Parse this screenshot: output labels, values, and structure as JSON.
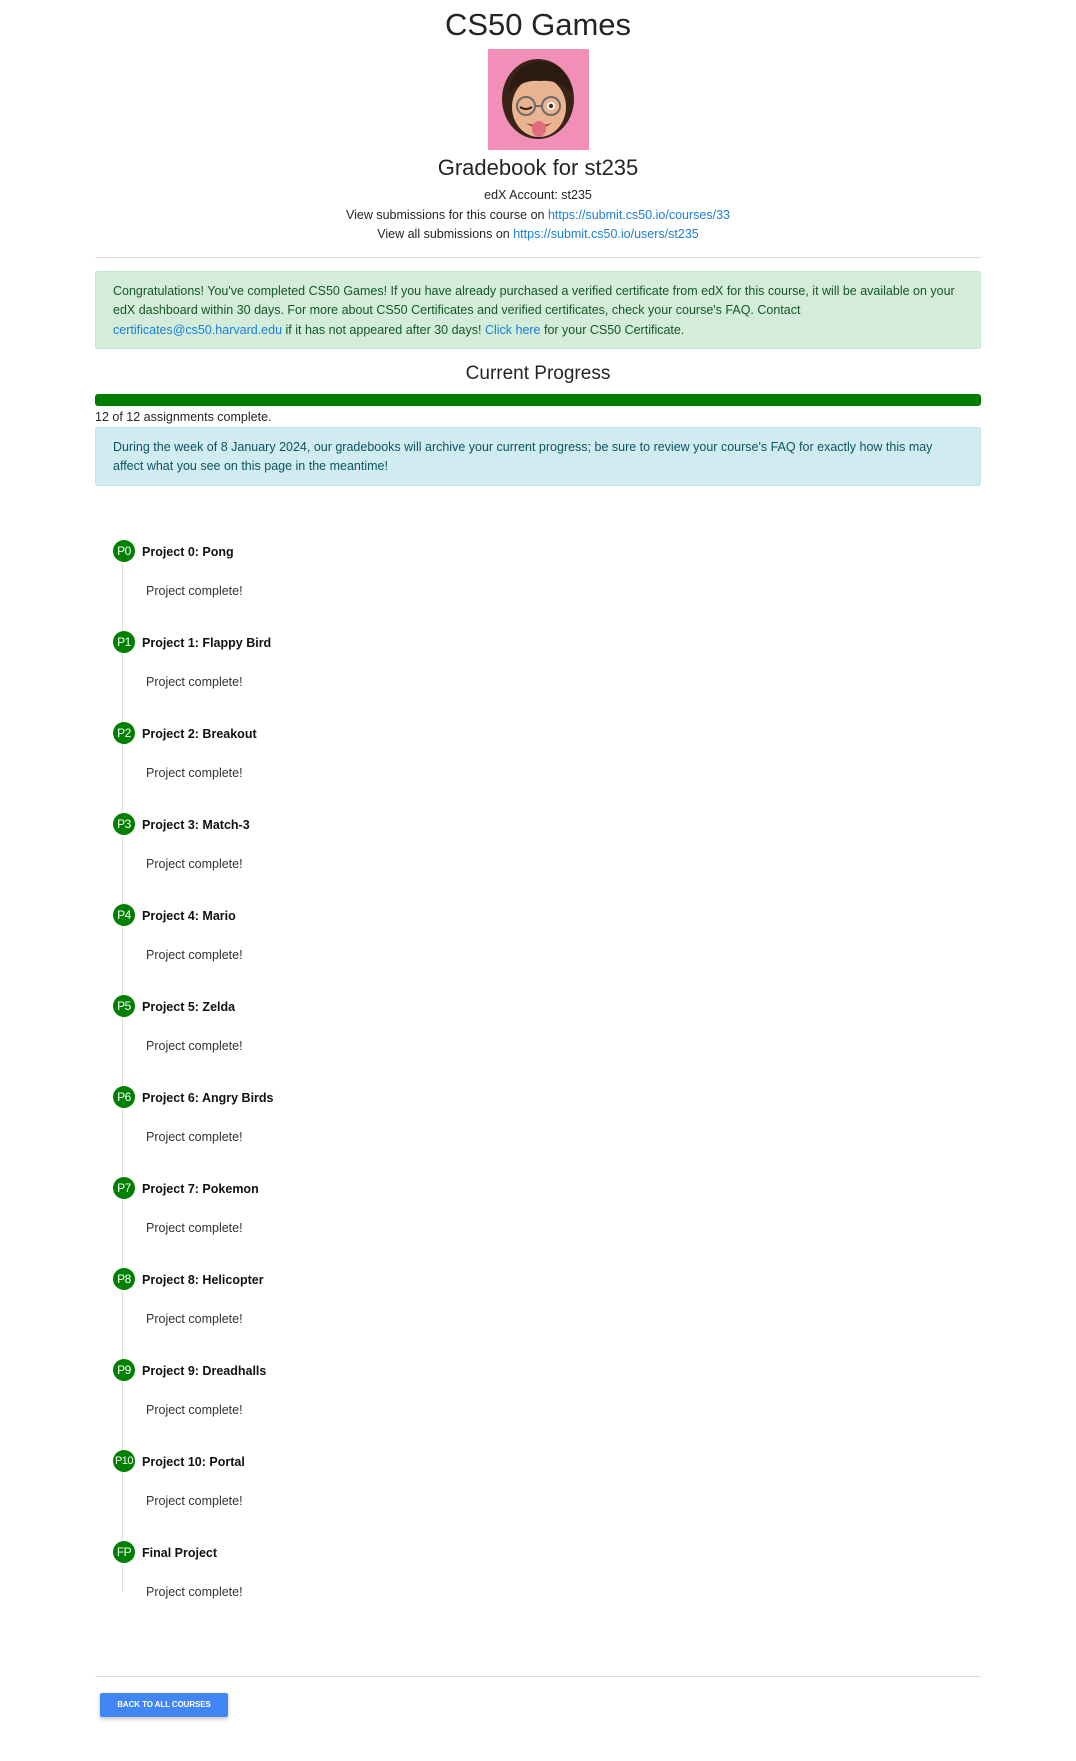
{
  "page": {
    "title": "CS50 Games",
    "subtitle": "Gradebook for st235",
    "edx_account_text": "edX Account: st235",
    "course_submissions_prefix": "View submissions for this course on ",
    "course_submissions_link": "https://submit.cs50.io/courses/33",
    "all_submissions_prefix": "View all submissions on ",
    "all_submissions_link": "https://submit.cs50.io/users/st235"
  },
  "avatar": {
    "icon": "memoji-avatar-icon",
    "background": "#f28fb8"
  },
  "congrats_alert": {
    "text_part1": "Congratulations! You've completed CS50 Games! If you have already purchased a verified certificate from edX for this course, it will be available on your edX dashboard within 30 days. For more about CS50 Certificates and verified certificates, check your course's FAQ. Contact ",
    "email_link": "certificates@cs50.harvard.edu",
    "text_part2": " if it has not appeared after 30 days! ",
    "click_here_link": "Click here",
    "text_part3": " for your CS50 Certificate."
  },
  "progress": {
    "title": "Current Progress",
    "completed": 12,
    "total": 12,
    "fraction": 1.0,
    "text": "12 of 12 assignments complete.",
    "bar_color": "#007e00"
  },
  "archive_notice": {
    "text": "During the week of 8 January 2024, our gradebooks will archive your current progress; be sure to review your course's FAQ for exactly how this may affect what you see on this page in the meantime!"
  },
  "projects": [
    {
      "badge": "P0",
      "title": "Project 0: Pong",
      "status": "Project complete!"
    },
    {
      "badge": "P1",
      "title": "Project 1: Flappy Bird",
      "status": "Project complete!"
    },
    {
      "badge": "P2",
      "title": "Project 2: Breakout",
      "status": "Project complete!"
    },
    {
      "badge": "P3",
      "title": "Project 3: Match-3",
      "status": "Project complete!"
    },
    {
      "badge": "P4",
      "title": "Project 4: Mario",
      "status": "Project complete!"
    },
    {
      "badge": "P5",
      "title": "Project 5: Zelda",
      "status": "Project complete!"
    },
    {
      "badge": "P6",
      "title": "Project 6: Angry Birds",
      "status": "Project complete!"
    },
    {
      "badge": "P7",
      "title": "Project 7: Pokemon",
      "status": "Project complete!"
    },
    {
      "badge": "P8",
      "title": "Project 8: Helicopter",
      "status": "Project complete!"
    },
    {
      "badge": "P9",
      "title": "Project 9: Dreadhalls",
      "status": "Project complete!"
    },
    {
      "badge": "P10",
      "title": "Project 10: Portal",
      "status": "Project complete!"
    },
    {
      "badge": "FP",
      "title": "Final Project",
      "status": "Project complete!"
    }
  ],
  "colors": {
    "badge": "#008000",
    "link": "#1b7ed6",
    "button": "#4285f4"
  },
  "footer": {
    "back_button_label": "Back to all courses"
  }
}
